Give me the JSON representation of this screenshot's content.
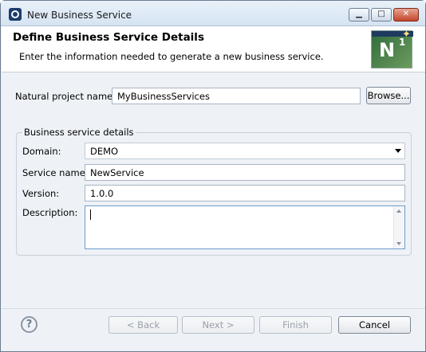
{
  "window": {
    "title": "New Business Service",
    "app_icon": "eclipse-icon",
    "min_icon": "minimize-icon",
    "max_icon": "maximize-icon",
    "close_icon": "close-icon"
  },
  "header": {
    "title": "Define Business Service Details",
    "description": "Enter the information needed to generate a new business service.",
    "banner_text": "N",
    "banner_superscript": "1"
  },
  "project": {
    "label": "Natural project name:",
    "value": "MyBusinessServices",
    "browse_label": "Browse..."
  },
  "details": {
    "group_label": "Business service details",
    "domain_label": "Domain:",
    "domain_value": "DEMO",
    "service_label": "Service name:",
    "service_value": "NewService",
    "version_label": "Version:",
    "version_value": "1.0.0",
    "description_label": "Description:",
    "description_value": ""
  },
  "footer": {
    "back_label": "< Back",
    "next_label": "Next >",
    "finish_label": "Finish",
    "cancel_label": "Cancel",
    "help_glyph": "?"
  }
}
